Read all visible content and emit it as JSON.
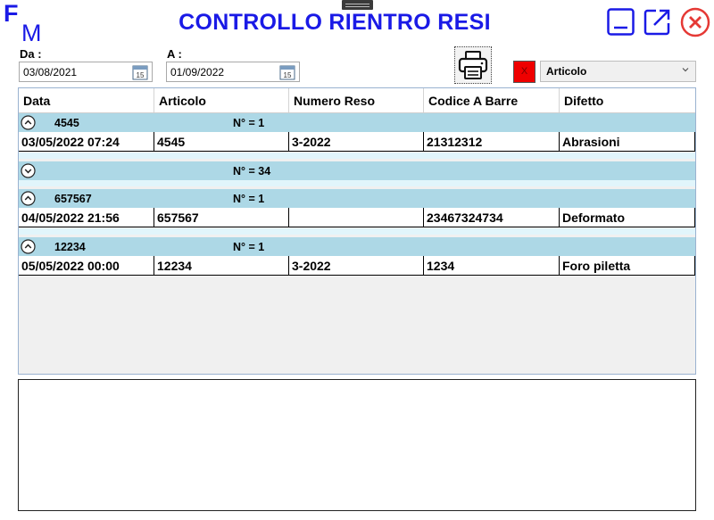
{
  "logo": {
    "letter_top": "F",
    "letter_bottom": "M",
    "color": "#1a1ae6"
  },
  "title": "CONTROLLO RIENTRO RESI",
  "window_controls": {
    "minimize": "minimize-icon",
    "popout": "popout-icon",
    "close": "close-icon"
  },
  "filters": {
    "from_label": "Da :",
    "from_value": "03/08/2021",
    "to_label": "A :",
    "to_value": "01/09/2022",
    "calendar_day": "15",
    "red_button_label": "X",
    "group_by_selected": "Articolo"
  },
  "grid": {
    "columns": [
      "Data",
      "Articolo",
      "Numero Reso",
      "Codice A Barre",
      "Difetto"
    ],
    "groups": [
      {
        "key": "4545",
        "count_label": "N° = 1",
        "expanded": true,
        "rows": [
          [
            "03/05/2022 07:24",
            "4545",
            "3-2022",
            "21312312",
            "Abrasioni"
          ]
        ]
      },
      {
        "key": "",
        "count_label": "N° = 34",
        "expanded": false,
        "rows": []
      },
      {
        "key": "657567",
        "count_label": "N° = 1",
        "expanded": true,
        "rows": [
          [
            "04/05/2022 21:56",
            "657567",
            "",
            "23467324734",
            "Deformato"
          ]
        ]
      },
      {
        "key": "12234",
        "count_label": "N° = 1",
        "expanded": true,
        "rows": [
          [
            "05/05/2022 00:00",
            "12234",
            "3-2022",
            "1234",
            "Foro piletta"
          ]
        ]
      }
    ]
  },
  "colors": {
    "accent": "#1a1ae6",
    "group_header": "#add8e6",
    "group_spacer": "#e1f5fb",
    "close_red": "#e53935",
    "red_box": "#ef0000"
  }
}
